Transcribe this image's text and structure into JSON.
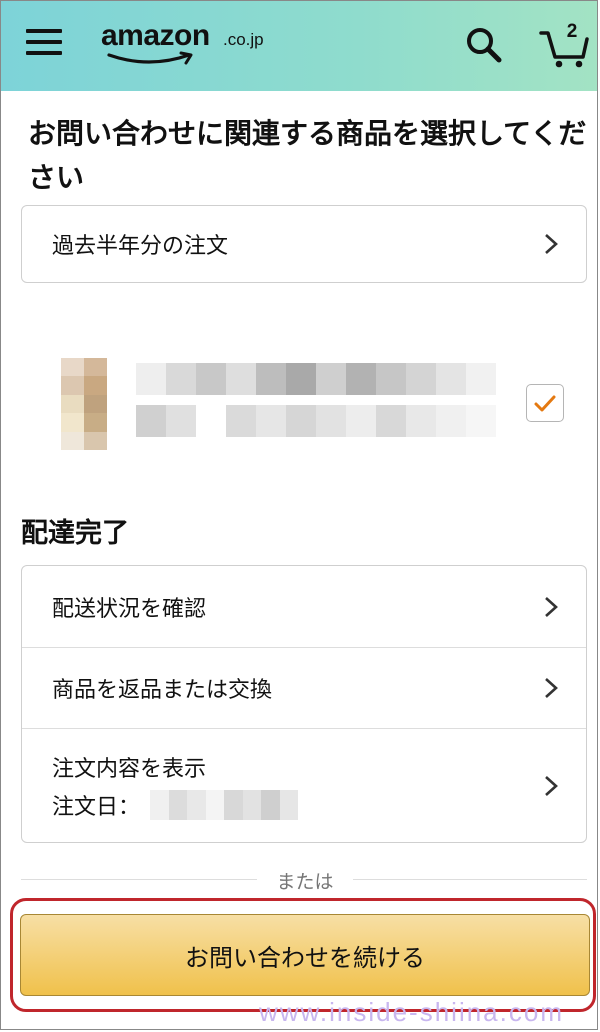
{
  "header": {
    "logo_main": "amazon",
    "logo_suffix": ".co.jp",
    "cart_count": "2",
    "icons": [
      "menu-icon",
      "search-icon",
      "cart-icon"
    ]
  },
  "page_title": "お問い合わせに関連する商品を選択してください",
  "past_orders_label": "過去半年分の注文",
  "product": {
    "selected": true
  },
  "delivery_section": {
    "title": "配達完了",
    "rows": [
      {
        "label": "配送状況を確認"
      },
      {
        "label": "商品を返品または交換"
      },
      {
        "label": "注文内容を表示",
        "sub_label": "注文日："
      }
    ]
  },
  "or_text": "または",
  "continue_button": "お問い合わせを続ける",
  "watermark": "www.inside-shiina.com",
  "colors": {
    "header_gradient_start": "#7dd3d8",
    "header_gradient_end": "#a3e3c4",
    "button_yellow": "#f0c14b",
    "highlight_red": "#c0262c",
    "check_orange": "#e47911",
    "watermark": "#c8b6ef"
  }
}
